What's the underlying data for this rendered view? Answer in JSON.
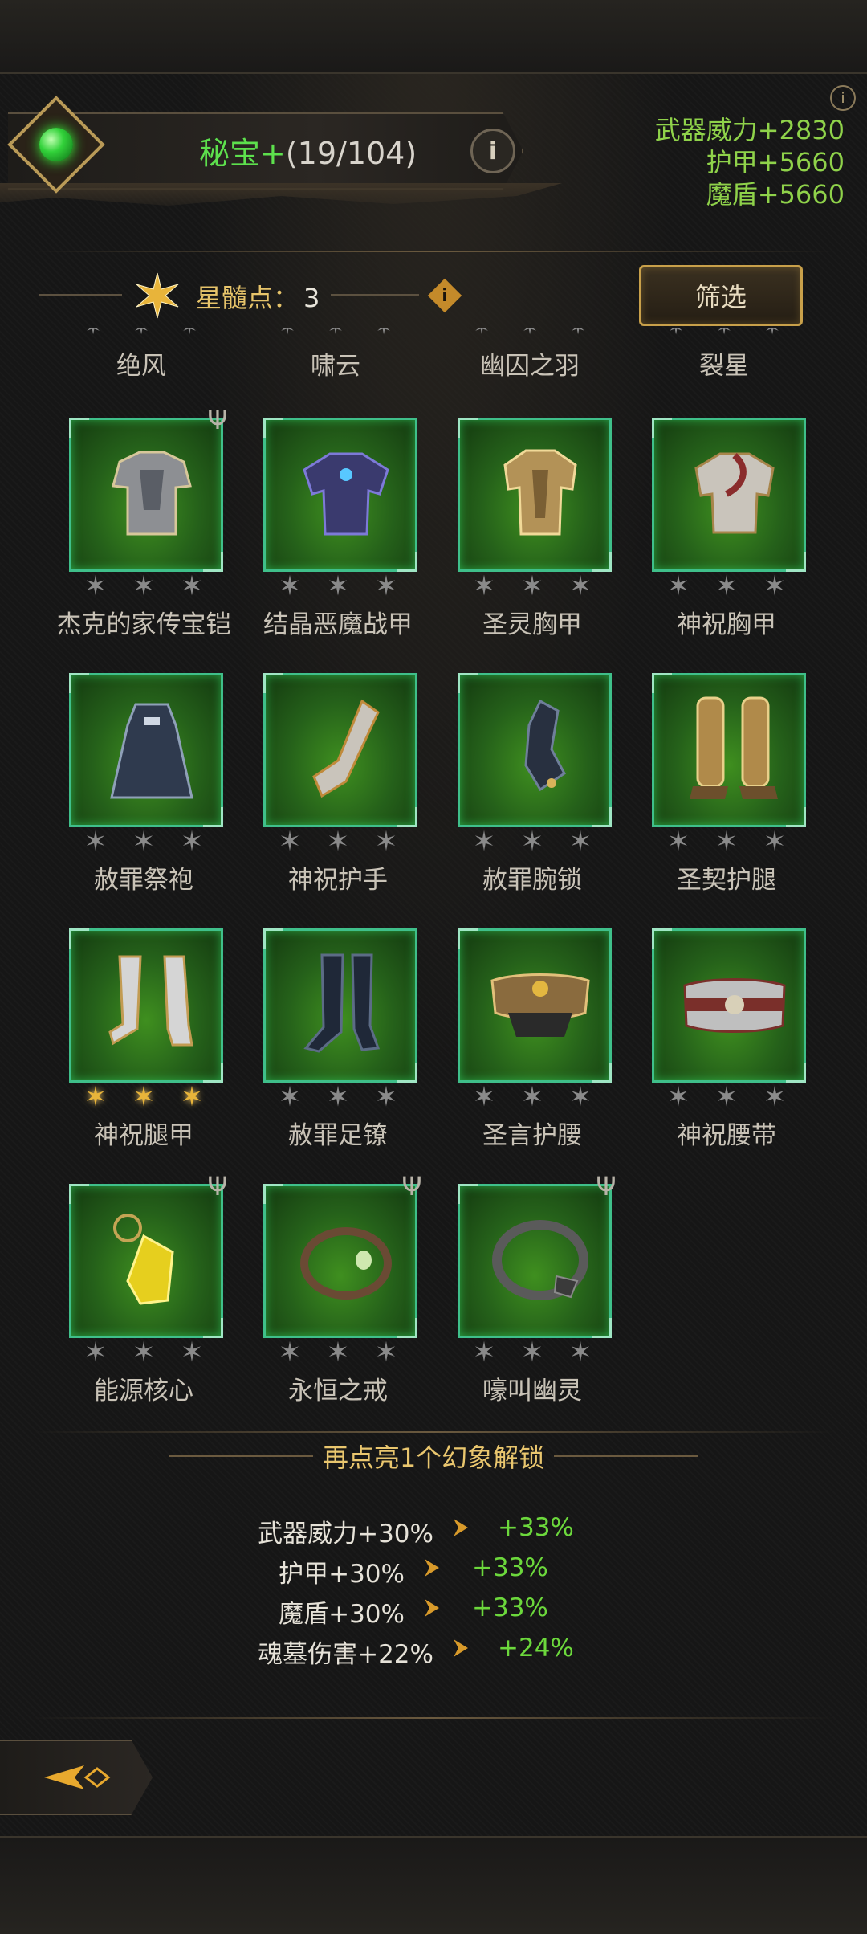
{
  "header": {
    "title_label": "秘宝+",
    "title_count": "(19/104)",
    "info_icon": "info-icon",
    "stats": [
      "武器威力+2830",
      "护甲+5660",
      "魔盾+5660"
    ]
  },
  "toolbar": {
    "star_label": "星髓点：",
    "star_points": "3",
    "filter_label": "筛选"
  },
  "partial_row": [
    "绝风",
    "啸云",
    "幽囚之羽",
    "裂星"
  ],
  "items": [
    {
      "name": "杰克的家传宝铠",
      "icon": "chest-armor-icon",
      "gold_stars": 0,
      "trident": true
    },
    {
      "name": "结晶恶魔战甲",
      "icon": "crystal-armor-icon",
      "gold_stars": 0,
      "trident": false
    },
    {
      "name": "圣灵胸甲",
      "icon": "holy-breastplate-icon",
      "gold_stars": 0,
      "trident": false
    },
    {
      "name": "神祝胸甲",
      "icon": "blessed-breastplate-icon",
      "gold_stars": 0,
      "trident": false
    },
    {
      "name": "赦罪祭袍",
      "icon": "robe-icon",
      "gold_stars": 0,
      "trident": false
    },
    {
      "name": "神祝护手",
      "icon": "gauntlet-icon",
      "gold_stars": 0,
      "trident": false
    },
    {
      "name": "赦罪腕锁",
      "icon": "wrist-chain-icon",
      "gold_stars": 0,
      "trident": false
    },
    {
      "name": "圣契护腿",
      "icon": "greaves-icon",
      "gold_stars": 0,
      "trident": false
    },
    {
      "name": "神祝腿甲",
      "icon": "leg-armor-icon",
      "gold_stars": 3,
      "trident": false
    },
    {
      "name": "赦罪足镣",
      "icon": "boots-icon",
      "gold_stars": 0,
      "trident": false
    },
    {
      "name": "圣言护腰",
      "icon": "waist-guard-icon",
      "gold_stars": 0,
      "trident": false
    },
    {
      "name": "神祝腰带",
      "icon": "belt-icon",
      "gold_stars": 0,
      "trident": false
    },
    {
      "name": "能源核心",
      "icon": "energy-core-icon",
      "gold_stars": 0,
      "trident": true
    },
    {
      "name": "永恒之戒",
      "icon": "ring-icon",
      "gold_stars": 0,
      "trident": true
    },
    {
      "name": "嚎叫幽灵",
      "icon": "wolf-ring-icon",
      "gold_stars": 0,
      "trident": true
    }
  ],
  "bonus_panel": {
    "title": "再点亮1个幻象解锁",
    "rows": [
      {
        "label": "武器威力+30%",
        "value": "+33%"
      },
      {
        "label": "护甲+30%",
        "value": "+33%"
      },
      {
        "label": "魔盾+30%",
        "value": "+33%"
      },
      {
        "label": "魂墓伤害+22%",
        "value": "+24%"
      }
    ]
  },
  "colors": {
    "accent_green": "#5de04d",
    "stat_green": "#8fd24a",
    "gold": "#e8b43a",
    "tile_border": "#3fbf8a"
  }
}
